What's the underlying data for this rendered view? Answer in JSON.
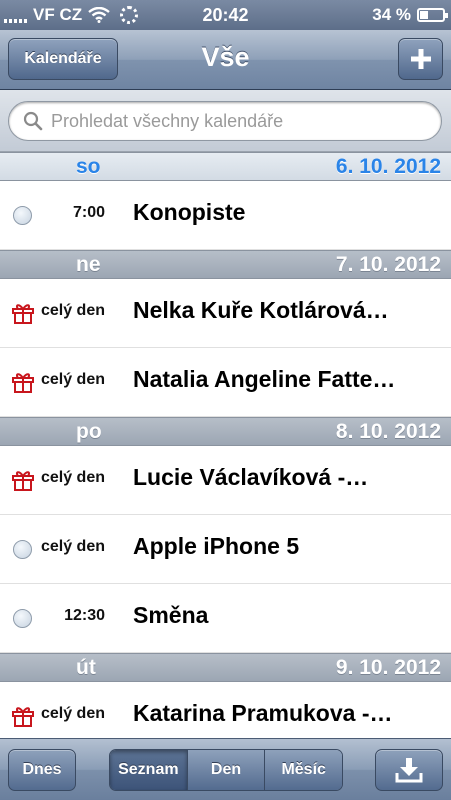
{
  "status_bar": {
    "carrier": "VF CZ",
    "time": "20:42",
    "battery_percent": "34 %",
    "battery_level": 0.34
  },
  "nav": {
    "title": "Vše",
    "calendars_button": "Kalendáře",
    "add_button": "+"
  },
  "search": {
    "placeholder": "Prohledat všechny kalendáře"
  },
  "sections": [
    {
      "day": "so",
      "date": "6. 10. 2012",
      "is_today": true,
      "events": [
        {
          "marker": "calendar-dot-icon",
          "time": "7:00",
          "title": "Konopiste"
        }
      ]
    },
    {
      "day": "ne",
      "date": "7. 10. 2012",
      "is_today": false,
      "events": [
        {
          "marker": "gift-icon",
          "time": "celý den",
          "title": "Nelka Kuře Kotlárová…"
        },
        {
          "marker": "gift-icon",
          "time": "celý den",
          "title": "Natalia Angeline Fatte…"
        }
      ]
    },
    {
      "day": "po",
      "date": "8. 10. 2012",
      "is_today": false,
      "events": [
        {
          "marker": "gift-icon",
          "time": "celý den",
          "title": "Lucie Václavíková -…"
        },
        {
          "marker": "calendar-dot-icon",
          "time": "celý den",
          "title": "Apple iPhone 5"
        },
        {
          "marker": "calendar-dot-icon",
          "time": "12:30",
          "title": "Směna"
        }
      ]
    },
    {
      "day": "út",
      "date": "9. 10. 2012",
      "is_today": false,
      "events": [
        {
          "marker": "gift-icon",
          "time": "celý den",
          "title": "Katarina Pramukova -…"
        }
      ]
    }
  ],
  "toolbar": {
    "today_button": "Dnes",
    "segments": [
      "Seznam",
      "Den",
      "Měsíc"
    ],
    "selected_segment": "Seznam",
    "download_icon": "download-tray-icon"
  },
  "colors": {
    "today_header_text": "#2a84e8",
    "gift_icon": "#c8161d"
  }
}
